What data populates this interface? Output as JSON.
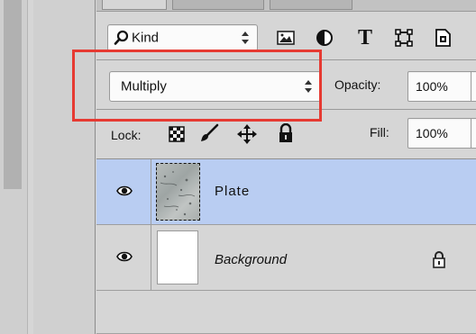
{
  "filter": {
    "kind_label": "Kind"
  },
  "blend": {
    "mode": "Multiply",
    "opacity_label": "Opacity:",
    "opacity_value": "100%"
  },
  "lock": {
    "label": "Lock:",
    "fill_label": "Fill:",
    "fill_value": "100%"
  },
  "layers": [
    {
      "name": "Plate",
      "selected": true,
      "visible": true,
      "locked": false
    },
    {
      "name": "Background",
      "selected": false,
      "visible": true,
      "locked": true
    }
  ],
  "icons": {
    "search": "search-icon",
    "image_filter": "image-layer-filter-icon",
    "adjust_filter": "adjustment-layer-filter-icon",
    "type_filter": "type-layer-filter-icon",
    "shape_filter": "shape-layer-filter-icon",
    "smart_filter": "smart-object-filter-icon",
    "lock_pixels": "checkerboard-icon",
    "lock_image": "brush-icon",
    "lock_position": "move-icon",
    "lock_all": "lock-icon",
    "eye": "eye-icon"
  },
  "colors": {
    "selection": "#b9cdf2",
    "highlight": "#e63a32"
  }
}
